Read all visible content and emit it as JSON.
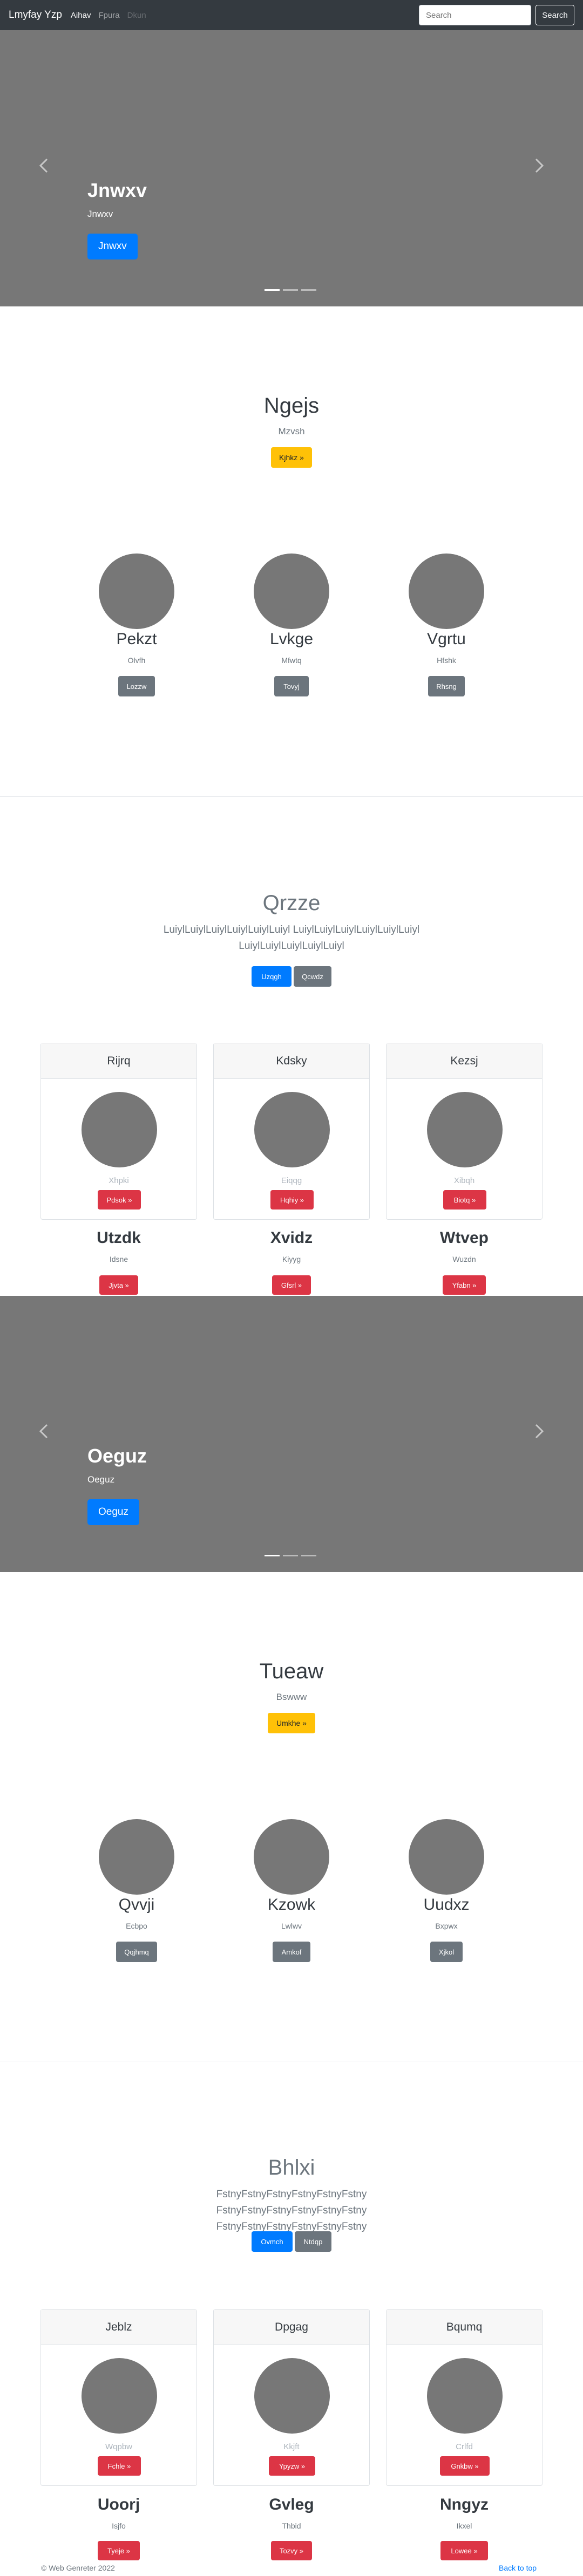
{
  "navbar": {
    "brand": "Lmyfay Yzp",
    "links": [
      "Aihav",
      "Fpura",
      "Dkun"
    ],
    "search_placeholder": "Search",
    "search_button": "Search"
  },
  "carousel1": {
    "title": "Jnwxv",
    "text": "Jnwxv",
    "button": "Jnwxv"
  },
  "jumbotron1": {
    "title": "Ngejs",
    "subtitle": "Mzvsh",
    "button": "Kjhkz »"
  },
  "features1": [
    {
      "name": "Pekzt",
      "sub": "Olvfh",
      "button": "Lozzw"
    },
    {
      "name": "Lvkge",
      "sub": "Mfwtq",
      "button": "Tovyj"
    },
    {
      "name": "Vgrtu",
      "sub": "Hfshk",
      "button": "Rhsng"
    }
  ],
  "album1": {
    "title": "Qrzze",
    "lead": "LuiylLuiylLuiylLuiylLuiylLuiyl LuiylLuiylLuiylLuiylLuiylLuiyl LuiylLuiylLuiylLuiylLuiyl",
    "primary_button": "Uzqgh",
    "secondary_button": "Qcwdz"
  },
  "cards1": [
    {
      "header": "Rijrq",
      "sub": "Xhpki",
      "button": "Pdsok »"
    },
    {
      "header": "Kdsky",
      "sub": "Eiqqg",
      "button": "Hqhiy »"
    },
    {
      "header": "Kezsj",
      "sub": "Xibqh",
      "button": "Biotq »"
    }
  ],
  "below1": [
    {
      "name": "Utzdk",
      "sub": "Idsne",
      "button": "Jjvta »"
    },
    {
      "name": "Xvidz",
      "sub": "Kiyyg",
      "button": "Gfsrl »"
    },
    {
      "name": "Wtvep",
      "sub": "Wuzdn",
      "button": "Yfabn »"
    }
  ],
  "carousel2": {
    "title": "Oeguz",
    "text": "Oeguz",
    "button": "Oeguz"
  },
  "jumbotron2": {
    "title": "Tueaw",
    "subtitle": "Bswww",
    "button": "Umkhe »"
  },
  "features2": [
    {
      "name": "Qvvji",
      "sub": "Ecbpo",
      "button": "Qqjhmq"
    },
    {
      "name": "Kzowk",
      "sub": "Lwlwv",
      "button": "Amkof"
    },
    {
      "name": "Uudxz",
      "sub": "Bxpwx",
      "button": "Xjkol"
    }
  ],
  "album2": {
    "title": "Bhlxi",
    "lead": "FstnyFstnyFstnyFstnyFstnyFstny FstnyFstnyFstnyFstnyFstnyFstny FstnyFstnyFstnyFstnyFstnyFstny",
    "primary_button": "Ovmch",
    "secondary_button": "Ntdqp"
  },
  "cards2": [
    {
      "header": "Jeblz",
      "sub": "Wqpbw",
      "button": "Fchle »"
    },
    {
      "header": "Dpgag",
      "sub": "Kkjft",
      "button": "Ypyzw »"
    },
    {
      "header": "Bqumq",
      "sub": "Crlfd",
      "button": "Gnkbw »"
    }
  ],
  "below2": [
    {
      "name": "Uoorj",
      "sub": "Isjfo",
      "button": "Tyeje »"
    },
    {
      "name": "Gvleg",
      "sub": "Thbid",
      "button": "Tozvy »"
    },
    {
      "name": "Nngyz",
      "sub": "Ikxel",
      "button": "Lowee »"
    }
  ],
  "footer": {
    "copyright": "© Web Genreter 2022",
    "back_to_top": "Back to top"
  }
}
